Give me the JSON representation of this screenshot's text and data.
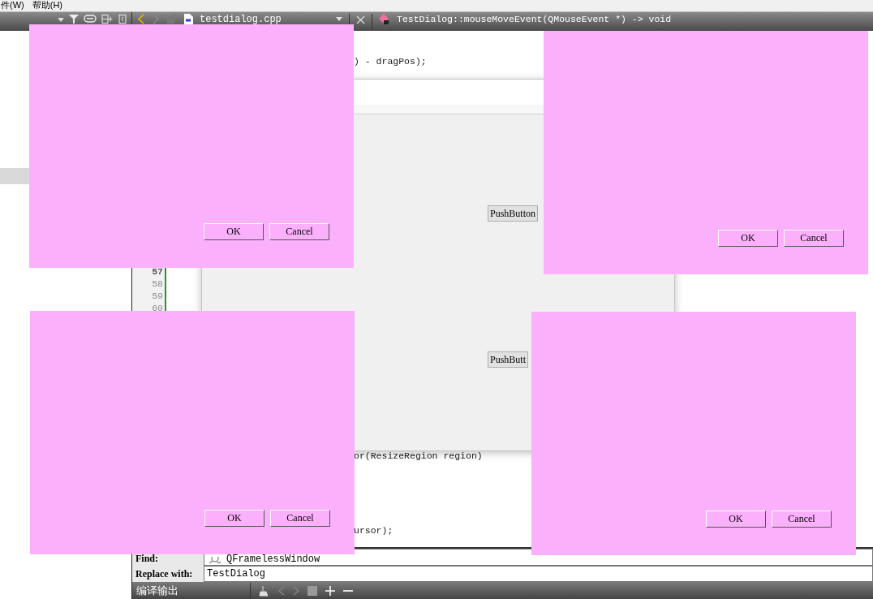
{
  "menu_bar": {
    "items": [
      "件(W)",
      "帮助(H)"
    ]
  },
  "editor_toolbar": {
    "file_name": "testdialog.cpp",
    "symbol": "TestDialog::mouseMoveEvent(QMouseEvent *) -> void"
  },
  "editor": {
    "gutter": [
      {
        "n": "57",
        "changed": true,
        "current": true
      },
      {
        "n": "58",
        "changed": true,
        "current": false
      },
      {
        "n": "59",
        "changed": true,
        "current": false
      },
      {
        "n": "60",
        "changed": true,
        "current": false
      }
    ],
    "fragments": [
      {
        "text": ") - dragPos);"
      },
      {
        "text": "or(ResizeRegion region)"
      },
      {
        "text": "ursor);"
      }
    ]
  },
  "main_window": {
    "buttons": [
      "PushButton",
      "PushButt"
    ]
  },
  "dialogs": [
    {
      "buttons": [
        "OK",
        "Cancel"
      ]
    },
    {
      "buttons": [
        "OK",
        "Cancel"
      ]
    },
    {
      "buttons": [
        "OK",
        "Cancel"
      ]
    },
    {
      "buttons": [
        "OK",
        "Cancel"
      ]
    }
  ],
  "find_bar": {
    "find_label": "Find:",
    "find_value": "QFramelessWindow",
    "replace_label": "Replace with:",
    "replace_value": "TestDialog"
  },
  "output_bar": {
    "title": "编译输出"
  }
}
